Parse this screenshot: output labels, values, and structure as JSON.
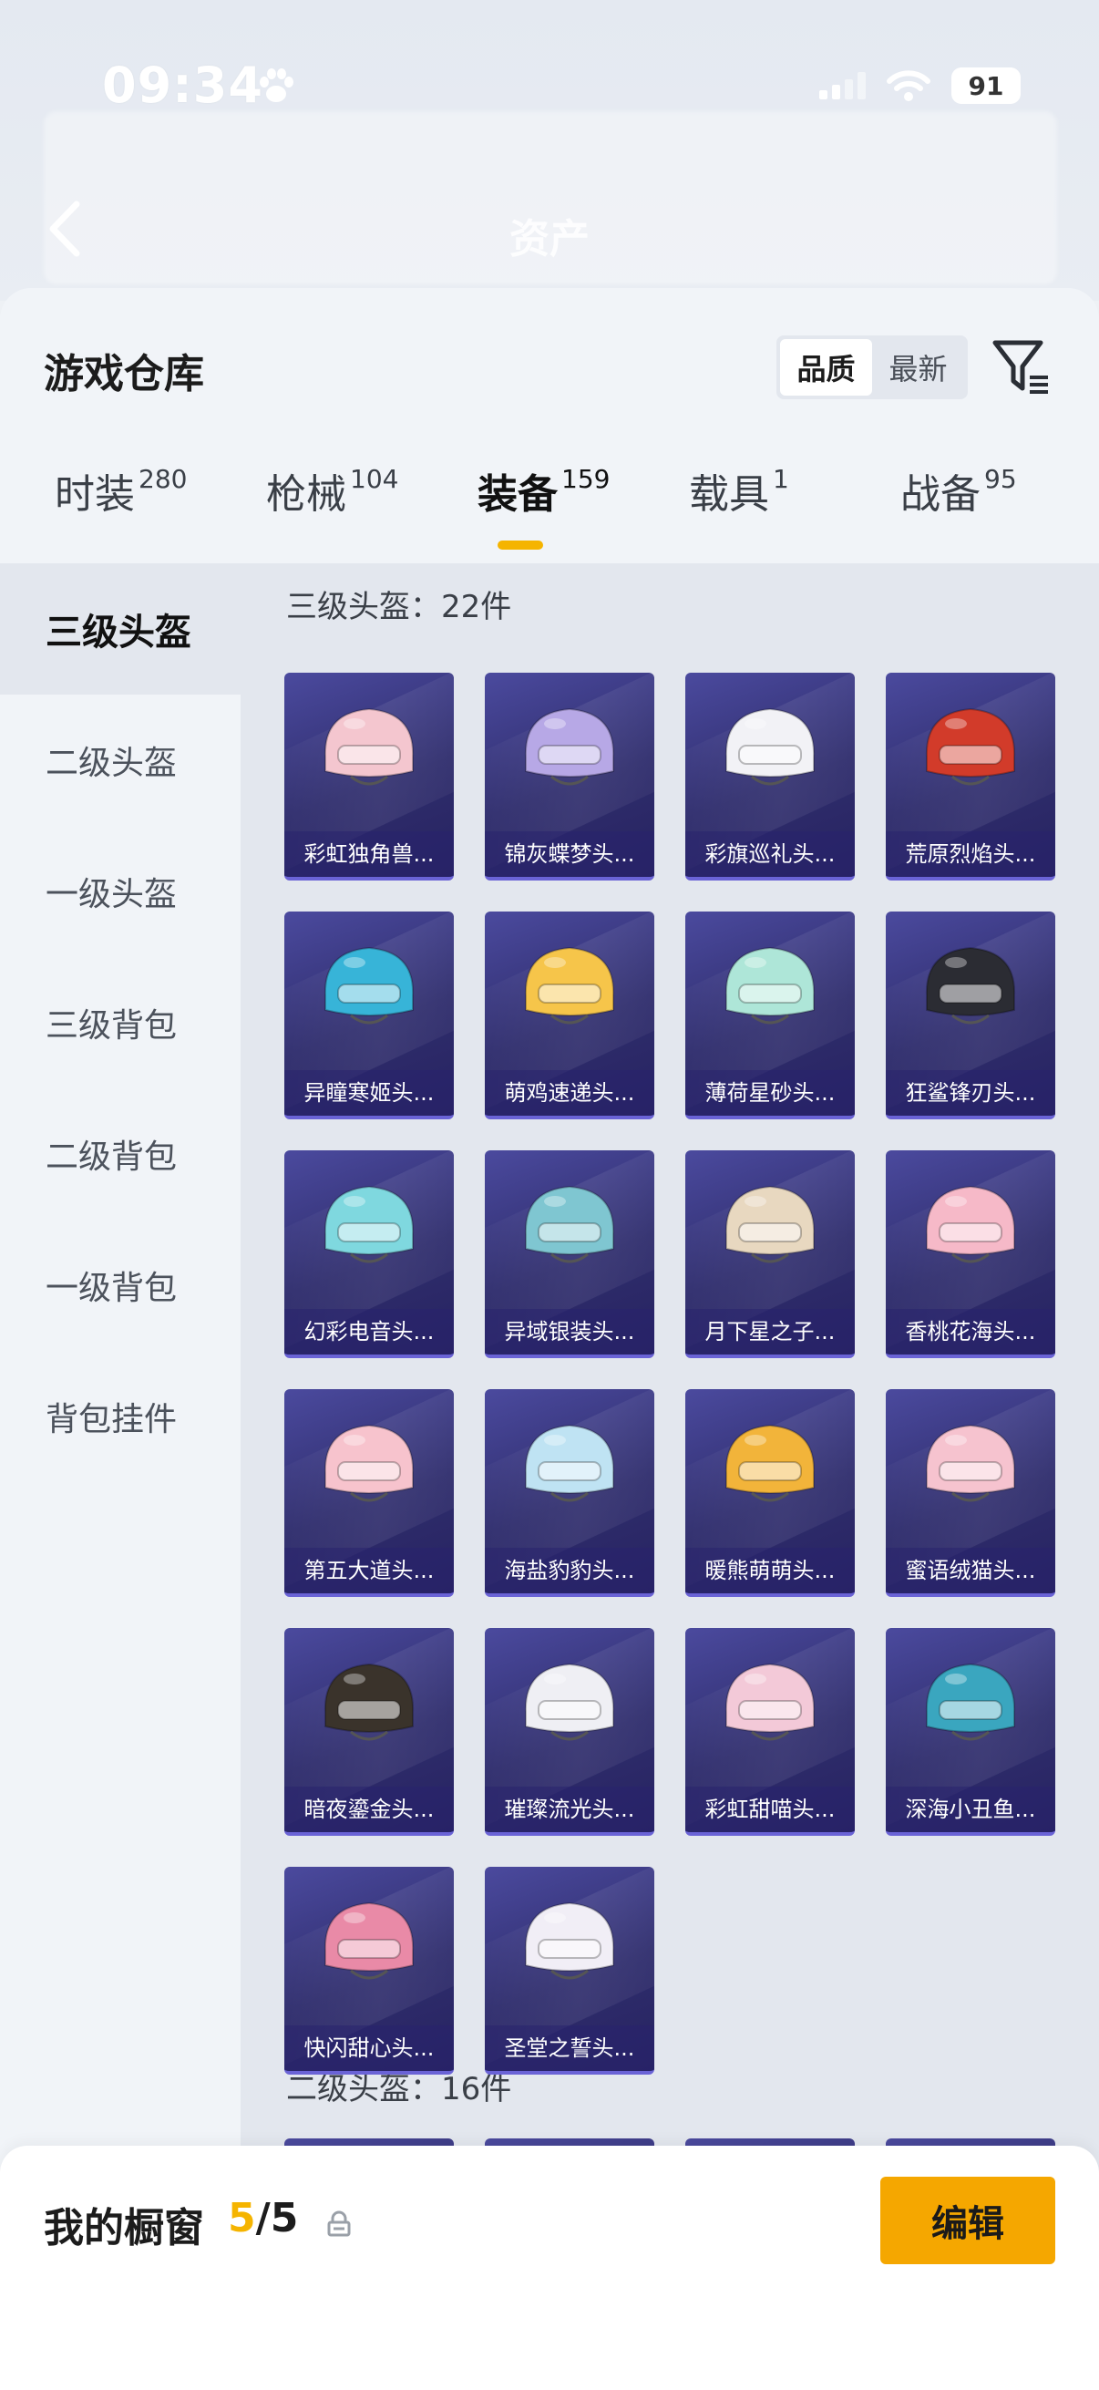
{
  "status": {
    "time": "09:34",
    "battery": "91"
  },
  "header": {
    "title": "资产"
  },
  "warehouse": {
    "title": "游戏仓库",
    "sort_options": [
      "品质",
      "最新"
    ],
    "tabs": [
      {
        "label": "时装",
        "count": "280"
      },
      {
        "label": "枪械",
        "count": "104"
      },
      {
        "label": "装备",
        "count": "159"
      },
      {
        "label": "载具",
        "count": "1"
      },
      {
        "label": "战备",
        "count": "95"
      }
    ],
    "categories": [
      "三级头盔",
      "二级头盔",
      "一级头盔",
      "三级背包",
      "二级背包",
      "一级背包",
      "背包挂件"
    ],
    "section1_heading": "三级头盔：22件",
    "items": [
      {
        "name": "彩虹独角兽...",
        "color": "#f4c6cf"
      },
      {
        "name": "锦灰蝶梦头...",
        "color": "#b7a8e6"
      },
      {
        "name": "彩旗巡礼头...",
        "color": "#f2f2f6"
      },
      {
        "name": "荒原烈焰头...",
        "color": "#d23b2a"
      },
      {
        "name": "异瞳寒姬头...",
        "color": "#37b4d8"
      },
      {
        "name": "萌鸡速递头...",
        "color": "#f6c54a"
      },
      {
        "name": "薄荷星砂头...",
        "color": "#aee6d8"
      },
      {
        "name": "狂鲨锋刃头...",
        "color": "#2b2c33"
      },
      {
        "name": "幻彩电音头...",
        "color": "#7fd8df"
      },
      {
        "name": "异域银装头...",
        "color": "#7fc6d1"
      },
      {
        "name": "月下星之子...",
        "color": "#e8d8c0"
      },
      {
        "name": "香桃花海头...",
        "color": "#f6b9c8"
      },
      {
        "name": "第五大道头...",
        "color": "#f7c3cd"
      },
      {
        "name": "海盐豹豹头...",
        "color": "#bfe3f3"
      },
      {
        "name": "暖熊萌萌头...",
        "color": "#f2b43a"
      },
      {
        "name": "蜜语绒猫头...",
        "color": "#f6c3cf"
      },
      {
        "name": "暗夜鎏金头...",
        "color": "#3a332b"
      },
      {
        "name": "璀璨流光头...",
        "color": "#efeff4"
      },
      {
        "name": "彩虹甜喵头...",
        "color": "#f3c9d8"
      },
      {
        "name": "深海小丑鱼...",
        "color": "#3aa6bf"
      },
      {
        "name": "快闪甜心头...",
        "color": "#e98aa7"
      },
      {
        "name": "圣堂之誓头...",
        "color": "#f1eef6"
      }
    ],
    "section2_heading": "二级头盔：16件"
  },
  "showcase": {
    "label": "我的橱窗",
    "current": "5",
    "separator": "/",
    "total": "5",
    "edit_label": "编辑"
  },
  "accent": "#f5b400"
}
